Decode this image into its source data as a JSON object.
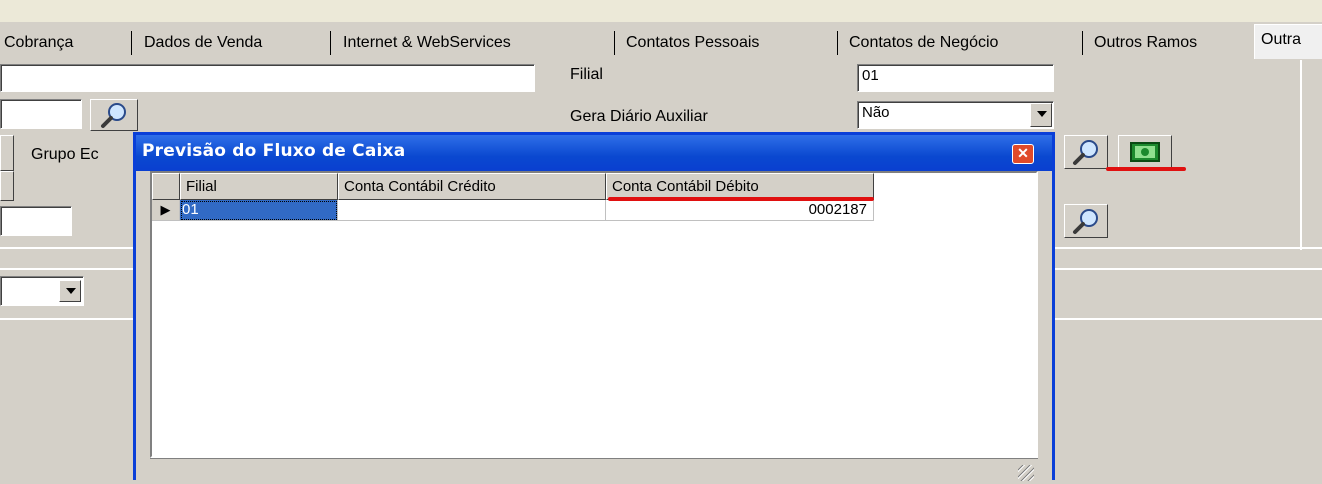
{
  "tabs": [
    {
      "label": "Cobrança"
    },
    {
      "label": "Dados de Venda"
    },
    {
      "label": "Internet & WebServices"
    },
    {
      "label": "Contatos Pessoais"
    },
    {
      "label": "Contatos de Negócio"
    },
    {
      "label": "Outros Ramos"
    },
    {
      "label": "Outra"
    }
  ],
  "form": {
    "filial_label": "Filial",
    "filial_value": "01",
    "gera_diario_label": "Gera Diário Auxiliar",
    "gera_diario_value": "Não",
    "grupo_label": "Grupo Ec"
  },
  "dialog": {
    "title": "Previsão do Fluxo de Caixa",
    "close_glyph": "✕",
    "columns": [
      "Filial",
      "Conta Contábil Crédito",
      "Conta Contábil Débito"
    ],
    "rows": [
      {
        "indicator": "▶",
        "filial": "01",
        "credito": "",
        "debito": "0002187"
      }
    ]
  },
  "icons": {
    "search": "search-icon",
    "money": "money-icon"
  },
  "colors": {
    "title_bar": "#0a48d0",
    "highlight": "#e01010",
    "selection": "#316ac5"
  }
}
